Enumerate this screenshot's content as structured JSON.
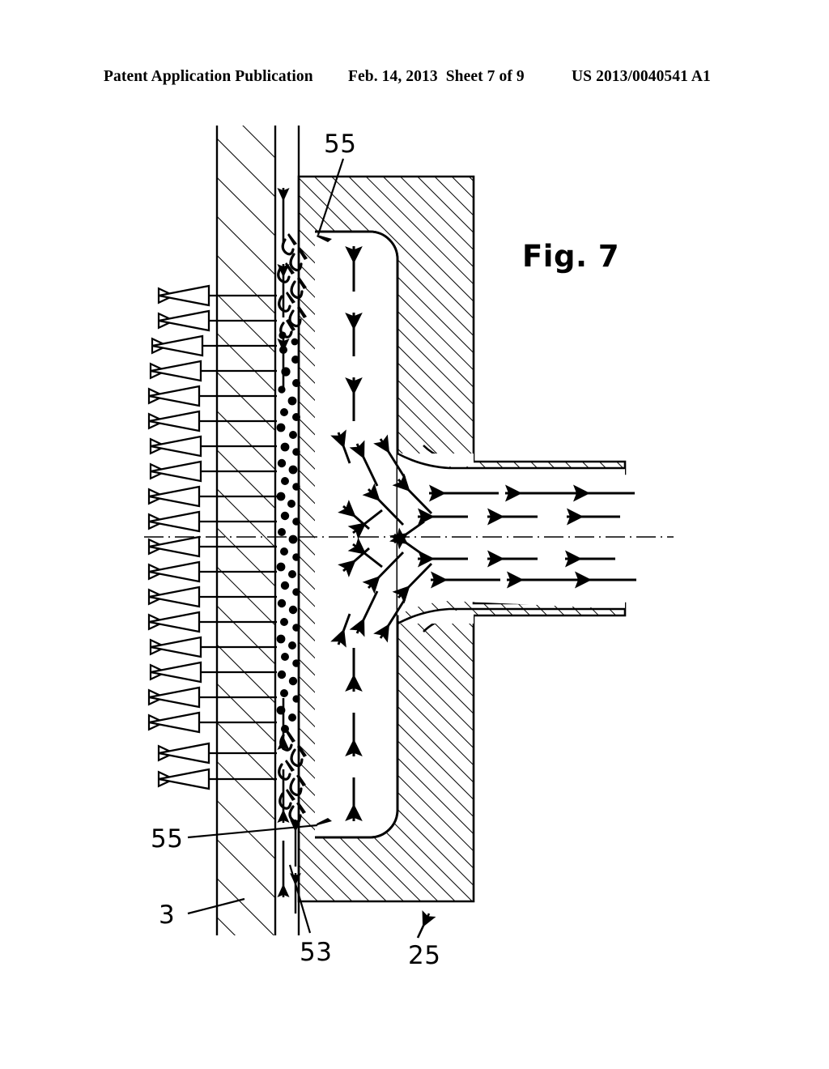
{
  "document": {
    "type": "patent-application-publication-drawing-sheet",
    "header": {
      "publication_text": "Patent Application Publication",
      "date": "Feb. 14, 2013",
      "sheet": "Sheet 7 of 9",
      "publication_number": "US 2013/0040541 A1"
    },
    "figure": {
      "label": "Fig. 7",
      "reference_numerals": [
        {
          "id": "55-top",
          "value": "55"
        },
        {
          "id": "55-bottom",
          "value": "55"
        },
        {
          "id": "3",
          "value": "3"
        },
        {
          "id": "53",
          "value": "53"
        },
        {
          "id": "25",
          "value": "25"
        }
      ]
    },
    "colors": {
      "ink": "#000000",
      "paper": "#ffffff"
    }
  }
}
